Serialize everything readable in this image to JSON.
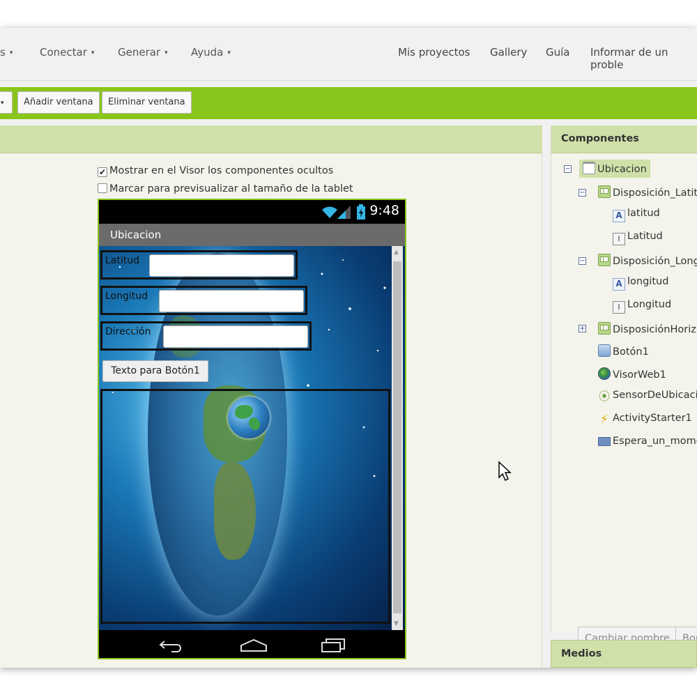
{
  "menu": [
    {
      "label": "s",
      "caret": "▾"
    },
    {
      "label": "Conectar",
      "caret": "▾"
    },
    {
      "label": "Generar",
      "caret": "▾"
    },
    {
      "label": "Ayuda",
      "caret": "▾"
    }
  ],
  "nav": {
    "projects": "Mis proyectos",
    "gallery": "Gallery",
    "guide": "Guía",
    "report": "Informar de un proble"
  },
  "toolbar": {
    "dropdown_caret": "▾",
    "add_screen": "Añadir ventana",
    "remove_screen": "Eliminar ventana"
  },
  "viewer": {
    "show_hidden_label": "Mostrar en el Visor los componentes ocultos",
    "show_hidden_checked": true,
    "tablet_preview_label": "Marcar para previsualizar al tamaño de la tablet",
    "tablet_preview_checked": false
  },
  "phone": {
    "time": "9:48",
    "app_title": "Ubicacion",
    "fields": [
      {
        "label": "Latitud"
      },
      {
        "label": "Longitud"
      },
      {
        "label": "Dirección"
      }
    ],
    "button_label": "Texto para Botón1"
  },
  "components": {
    "title": "Componentes",
    "tree": [
      {
        "label": "Ubicacion",
        "icon": "screen-icon",
        "toggle": "⊟"
      },
      {
        "label": "Disposición_Latit",
        "icon": "arrangement-icon",
        "toggle": "⊟"
      },
      {
        "label": "latitud",
        "icon": "label-icon"
      },
      {
        "label": "Latitud",
        "icon": "textbox-icon"
      },
      {
        "label": "Disposición_Long",
        "icon": "arrangement-icon",
        "toggle": "⊟"
      },
      {
        "label": "longitud",
        "icon": "label-icon"
      },
      {
        "label": "Longitud",
        "icon": "textbox-icon"
      },
      {
        "label": "DisposiciónHoriz",
        "icon": "arrangement-icon",
        "toggle": "⊞"
      },
      {
        "label": "Botón1",
        "icon": "button-icon"
      },
      {
        "label": "VisorWeb1",
        "icon": "webviewer-icon"
      },
      {
        "label": "SensorDeUbicaci",
        "icon": "location-sensor-icon"
      },
      {
        "label": "ActivityStarter1",
        "icon": "activity-starter-icon"
      },
      {
        "label": "Espera_un_mome",
        "icon": "notifier-icon"
      }
    ],
    "rename_button": "Cambiar nombre",
    "delete_button": "Bor"
  },
  "media": {
    "title": "Medios"
  }
}
